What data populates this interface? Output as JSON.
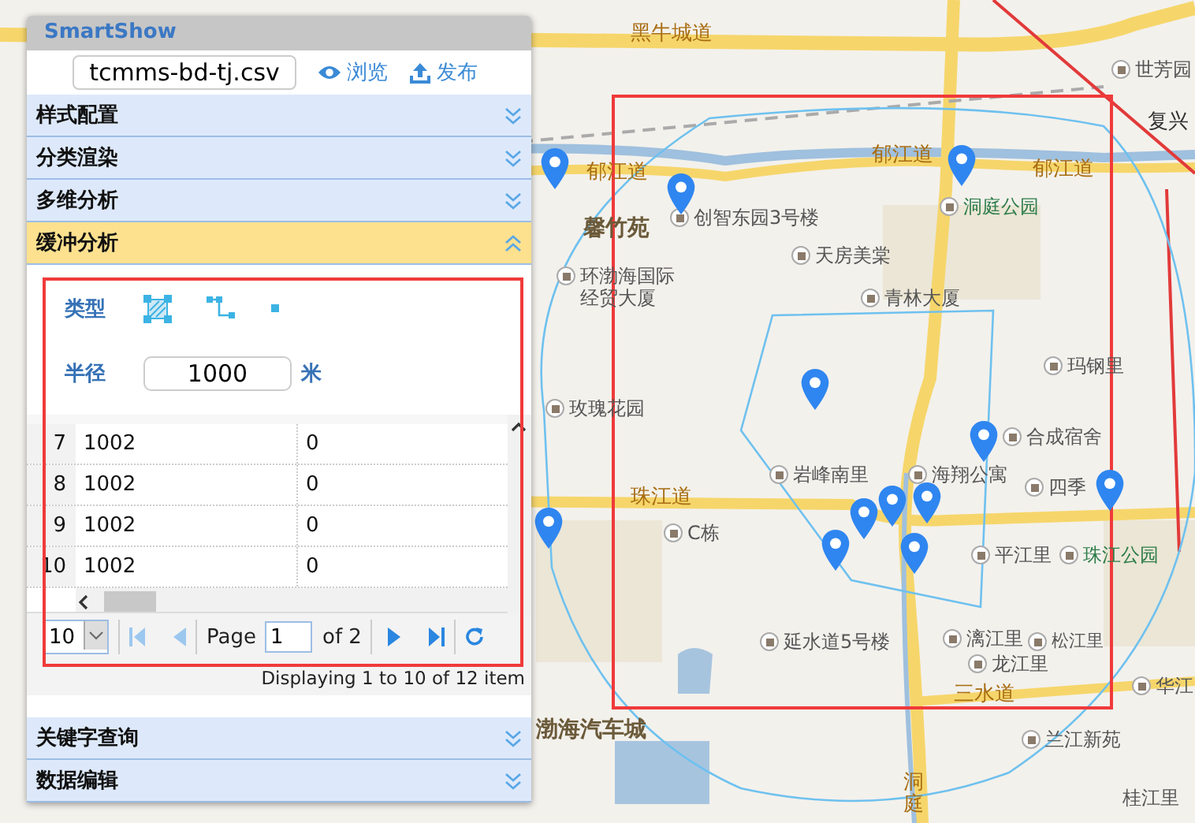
{
  "app": {
    "title": "SmartShow"
  },
  "file": {
    "value": "tcmms-bd-tj.csv"
  },
  "actions": [
    {
      "label": "浏览",
      "kind": "view"
    },
    {
      "label": "发布",
      "kind": "publish"
    }
  ],
  "sections": [
    {
      "label": "样式配置",
      "expanded": false
    },
    {
      "label": "分类渲染",
      "expanded": false
    },
    {
      "label": "多维分析",
      "expanded": false
    },
    {
      "label": "缓冲分析",
      "expanded": true
    },
    {
      "label": "关键字查询",
      "expanded": false
    },
    {
      "label": "数据编辑",
      "expanded": false
    }
  ],
  "buffer": {
    "type_label": "类型",
    "types": [
      {
        "kind": "polygon"
      },
      {
        "kind": "line"
      },
      {
        "kind": "point"
      }
    ],
    "radius_label": "半径",
    "radius": "1000",
    "unit": "米"
  },
  "grid": {
    "rows": [
      {
        "row_number": "7",
        "cells": [
          "1002",
          "0"
        ]
      },
      {
        "row_number": "8",
        "cells": [
          "1002",
          "0"
        ]
      },
      {
        "row_number": "9",
        "cells": [
          "1002",
          "0"
        ]
      },
      {
        "row_number": "10",
        "cells": [
          "1002",
          "0"
        ]
      }
    ]
  },
  "pager": {
    "page_size": "10",
    "page_label": "Page",
    "page": "1",
    "total_label": "of 2",
    "summary": "Displaying 1 to 10 of 12 item"
  },
  "map": {
    "labels": [
      {
        "text": "黑牛城道",
        "kind": "road"
      },
      {
        "text": "世芳园",
        "kind": "poi"
      },
      {
        "text": "复兴",
        "kind": "metro"
      },
      {
        "text": "郁江道",
        "kind": "road"
      },
      {
        "text": "郁江道",
        "kind": "road"
      },
      {
        "text": "郁江道",
        "kind": "road"
      },
      {
        "text": "馨竹苑",
        "kind": "area"
      },
      {
        "text": "创智东园3号楼",
        "kind": "poi"
      },
      {
        "text": "洞庭公园",
        "kind": "park"
      },
      {
        "text": "天房美棠",
        "kind": "poi"
      },
      {
        "text": "环渤海国际",
        "kind": "poi"
      },
      {
        "text": "经贸大厦",
        "kind": "plain"
      },
      {
        "text": "青林大厦",
        "kind": "poi"
      },
      {
        "text": "玛钢里",
        "kind": "poi"
      },
      {
        "text": "玫瑰花园",
        "kind": "poi"
      },
      {
        "text": "合成宿舍",
        "kind": "poi"
      },
      {
        "text": "岩峰南里",
        "kind": "poi"
      },
      {
        "text": "海翔公寓",
        "kind": "poi"
      },
      {
        "text": "四季",
        "kind": "poi"
      },
      {
        "text": "珠江道",
        "kind": "road"
      },
      {
        "text": "C栋",
        "kind": "poi"
      },
      {
        "text": "平江里",
        "kind": "poi"
      },
      {
        "text": "珠江公园",
        "kind": "park"
      },
      {
        "text": "延水道5号楼",
        "kind": "poi"
      },
      {
        "text": "漓江里",
        "kind": "poi"
      },
      {
        "text": "龙江里",
        "kind": "poi"
      },
      {
        "text": "松江里",
        "kind": "poi"
      },
      {
        "text": "华江",
        "kind": "poi"
      },
      {
        "text": "三水道",
        "kind": "road"
      },
      {
        "text": "渤海汽车城",
        "kind": "area"
      },
      {
        "text": "兰江新苑",
        "kind": "poi"
      },
      {
        "text": "桂江里",
        "kind": "plain"
      },
      {
        "text": "洞庭",
        "kind": "road-vertical"
      }
    ]
  }
}
